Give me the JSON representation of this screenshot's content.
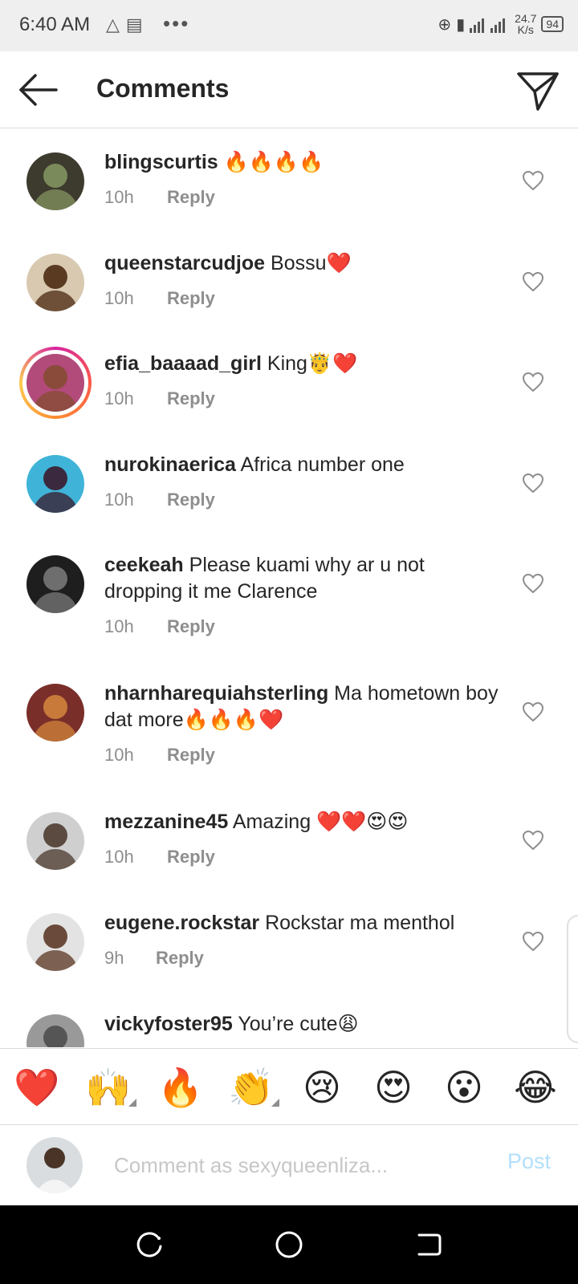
{
  "status_bar": {
    "time": "6:40 AM",
    "speed_value": "24.7",
    "speed_unit": "K/s",
    "battery": "94"
  },
  "header": {
    "title": "Comments"
  },
  "comments": [
    {
      "username": "blingscurtis",
      "text": "🔥🔥🔥🔥",
      "time": "10h",
      "reply": "Reply",
      "avatar_colors": [
        "#7b8a5a",
        "#3d3a2e"
      ]
    },
    {
      "username": "queenstarcudjoe",
      "text": "Bossu❤️",
      "time": "10h",
      "reply": "Reply",
      "avatar_colors": [
        "#5a3b22",
        "#d8c9b0"
      ]
    },
    {
      "username": "efia_baaaad_girl",
      "text": "King🤴❤️",
      "time": "10h",
      "reply": "Reply",
      "avatar_colors": [
        "#8a4b3a",
        "#b24a7a"
      ]
    },
    {
      "username": "nurokinaerica",
      "text": "Africa number one",
      "time": "10h",
      "reply": "Reply",
      "avatar_colors": [
        "#3b2a3f",
        "#3fb4d8"
      ]
    },
    {
      "username": "ceekeah",
      "text": "Please kuami why ar u not dropping it me Clarence",
      "time": "10h",
      "reply": "Reply",
      "avatar_colors": [
        "#6e6e6e",
        "#1e1e1e"
      ]
    },
    {
      "username": "nharnharequiahsterling",
      "text": "Ma hometown boy dat more🔥🔥🔥❤️",
      "time": "10h",
      "reply": "Reply",
      "avatar_colors": [
        "#c77a3a",
        "#7a2e2a"
      ]
    },
    {
      "username": "mezzanine45",
      "text": "Amazing ❤️❤️😍😍",
      "time": "10h",
      "reply": "Reply",
      "avatar_colors": [
        "#5a4a40",
        "#cfcfcf"
      ]
    },
    {
      "username": "eugene.rockstar",
      "text": "Rockstar ma menthol",
      "time": "9h",
      "reply": "Reply",
      "avatar_colors": [
        "#6a4a3a",
        "#e3e3e3"
      ]
    },
    {
      "username": "vickyfoster95",
      "text": "You’re cute😩",
      "time": "",
      "reply": "",
      "avatar_colors": [
        "#555555",
        "#999999"
      ]
    }
  ],
  "emoji_bar": [
    {
      "emoji": "❤️",
      "name": "heart"
    },
    {
      "emoji": "🙌",
      "name": "raising-hands"
    },
    {
      "emoji": "🔥",
      "name": "fire"
    },
    {
      "emoji": "👏",
      "name": "clapping-hands"
    },
    {
      "emoji": "😢",
      "name": "crying-face"
    },
    {
      "emoji": "😍",
      "name": "heart-eyes"
    },
    {
      "emoji": "😮",
      "name": "surprised-face"
    },
    {
      "emoji": "😂",
      "name": "tears-of-joy"
    }
  ],
  "composer": {
    "placeholder": "Comment as sexyqueenliza...",
    "post_label": "Post"
  },
  "colors": {
    "link_disabled": "#b2dffc",
    "secondary_text": "#8e8e8e",
    "divider": "#dbdbdb"
  }
}
